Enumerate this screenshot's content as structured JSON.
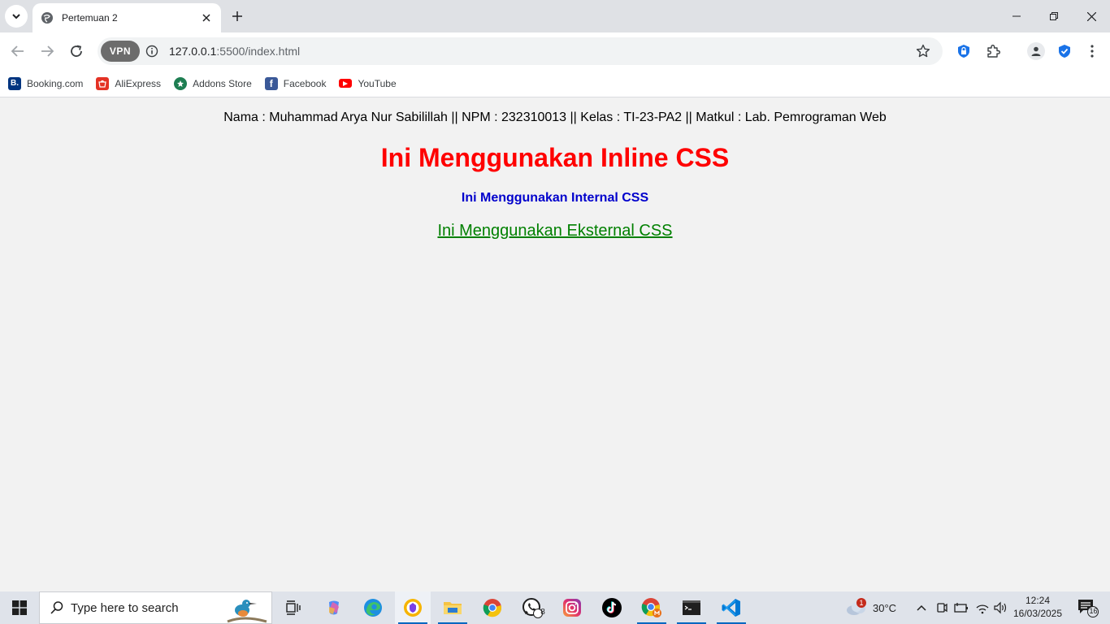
{
  "browser": {
    "tab_title": "Pertemuan 2",
    "url_host": "127.0.0.1",
    "url_path": ":5500/index.html",
    "vpn_label": "VPN"
  },
  "bookmarks": [
    {
      "label": "Booking.com",
      "icon": "booking-icon",
      "color": "#003580",
      "glyph": "B."
    },
    {
      "label": "AliExpress",
      "icon": "aliexpress-icon",
      "color": "#e43225",
      "glyph": ""
    },
    {
      "label": "Addons Store",
      "icon": "addons-store-icon",
      "color": "#1e7e52",
      "glyph": ""
    },
    {
      "label": "Facebook",
      "icon": "facebook-icon",
      "color": "#3b5998",
      "glyph": "f"
    },
    {
      "label": "YouTube",
      "icon": "youtube-icon",
      "color": "#ff0000",
      "glyph": ""
    }
  ],
  "page": {
    "identity": "Nama : Muhammad Arya Nur Sabilillah || NPM : 232310013 || Kelas : TI-23-PA2 || Matkul : Lab. Pemrograman Web",
    "inline_heading": "Ini Menggunakan Inline CSS",
    "internal_heading": "Ini Menggunakan Internal CSS",
    "external_heading": "Ini Menggunakan Eksternal CSS",
    "colors": {
      "inline": "#ff0000",
      "internal": "#0000cc",
      "external": "#008000"
    }
  },
  "taskbar": {
    "search_placeholder": "Type here to search",
    "weather_temp": "30°C",
    "weather_badge": "1",
    "whatsapp_badge": "8",
    "time": "12:24",
    "date": "16/03/2025",
    "notification_count": "16"
  }
}
